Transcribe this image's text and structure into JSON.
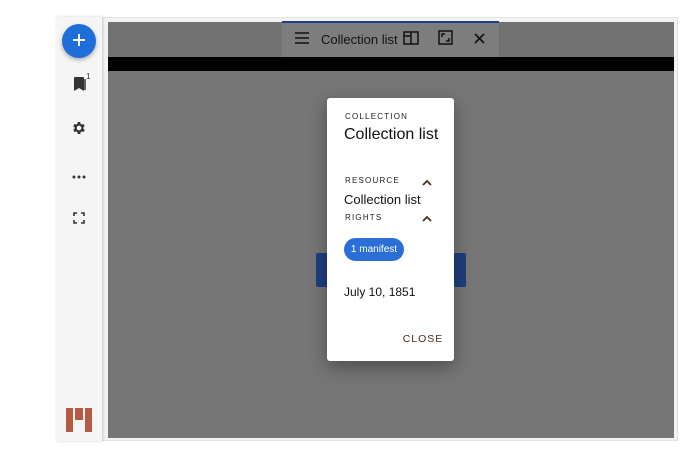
{
  "sidebar": {
    "add_icon": "plus-icon",
    "bookmark_badge": "1",
    "items": [
      {
        "icon": "bookmark-stack-icon"
      },
      {
        "icon": "gear-icon"
      },
      {
        "icon": "more-horizontal-icon"
      },
      {
        "icon": "fullscreen-icon"
      }
    ],
    "logo_icon": "mirador-logo-icon"
  },
  "window": {
    "title": "Collection list",
    "toolbar_icons": [
      "menu-icon",
      "split-view-icon",
      "maximize-icon",
      "close-icon"
    ]
  },
  "dialog": {
    "collection_overline": "COLLECTION",
    "title": "Collection list",
    "resource_overline": "RESOURCE",
    "resource_value": "Collection list",
    "rights_overline": "RIGHTS",
    "chip_label": "1 manifest",
    "date": "July 10, 1851",
    "close_label": "CLOSE"
  },
  "colors": {
    "accent": "#1e6fd9",
    "chip": "#2b6fd6",
    "logo": "#b75a44",
    "overlay": "#767676"
  }
}
